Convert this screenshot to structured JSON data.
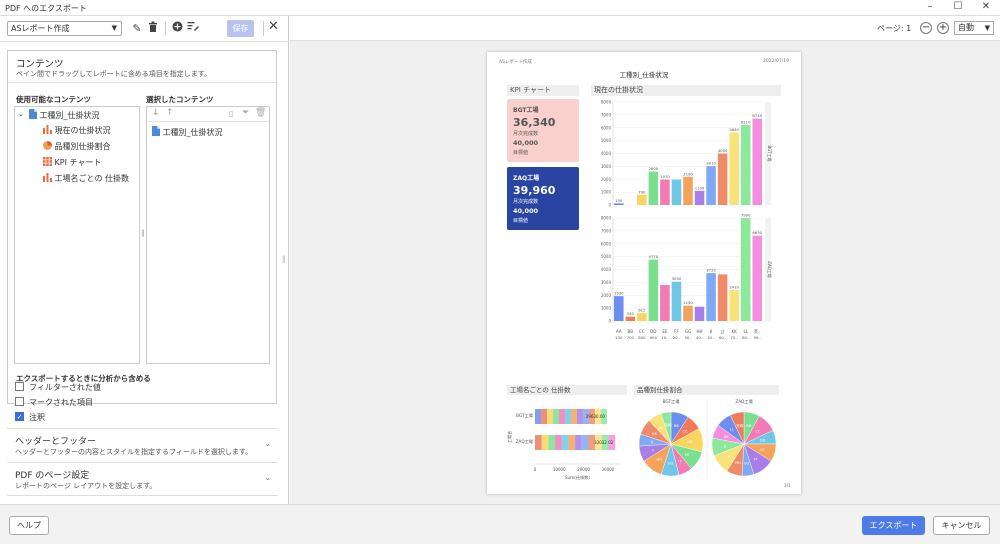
{
  "window": {
    "title": "PDF へのエクスポート"
  },
  "toolbar": {
    "report_select": "ASレポート作成",
    "save_label": "保存"
  },
  "content": {
    "heading": "コンテンツ",
    "description": "ペイン間でドラッグしてレポートに含める項目を指定します。",
    "available_label": "使用可能なコンテンツ",
    "selected_label": "選択したコンテンツ",
    "tree_root": "工種別_仕掛状況",
    "tree_items": [
      "現在の仕掛状況",
      "品種別仕掛割合",
      "KPI チャート",
      "工場名ごとの 仕掛数"
    ],
    "selected_items": [
      "工種別_仕掛状況"
    ]
  },
  "export_options": {
    "heading": "エクスポートするときに分析から含める",
    "items": [
      {
        "label": "フィルターされた値",
        "checked": false
      },
      {
        "label": "マークされた項目",
        "checked": false
      },
      {
        "label": "注釈",
        "checked": true
      }
    ]
  },
  "header_footer": {
    "heading": "ヘッダーとフッター",
    "description": "ヘッダーとフッターの内容とスタイルを指定するフィールドを選択します。"
  },
  "pdf_settings": {
    "heading": "PDF のページ設定",
    "description": "レポートのページ レイアウトを設定します。"
  },
  "preview": {
    "page_label": "ページ: 1",
    "zoom": "自動",
    "doc_header_left": "ASレポート作成",
    "doc_header_right": "2022/07/19",
    "doc_title": "工種別_仕掛状況",
    "footer_page": "1/1",
    "kpi_title": "KPI チャート",
    "kpi_cards": [
      {
        "name": "BGT工場",
        "value": "36,340",
        "value_label": "月次完成数",
        "target": "40,000",
        "target_label": "目標値"
      },
      {
        "name": "ZAQ工場",
        "value": "39,960",
        "value_label": "月次完成数",
        "target": "40,000",
        "target_label": "目標値"
      }
    ],
    "status_title": "現在の仕掛状況",
    "factories_title": "工場名ごとの 仕掛数",
    "pie_title": "品種別仕掛割合"
  },
  "chart_data": [
    {
      "type": "bar",
      "title": "現在の仕掛状況",
      "categories": [
        "AA",
        "BB",
        "CC",
        "DD",
        "EE",
        "FF",
        "GG",
        "HH",
        "II",
        "JJ",
        "KK",
        "LL",
        "荒.."
      ],
      "category_sublabels": [
        "130",
        "700",
        "800",
        "900",
        "10..",
        "20..",
        "30..",
        "40..",
        "50..",
        "60..",
        "70..",
        "80..",
        "99.."
      ],
      "ylim": [
        0,
        8000
      ],
      "yticks": [
        0,
        1000,
        2000,
        3000,
        4000,
        5000,
        6000,
        7000,
        8000
      ],
      "series": [
        {
          "name": "BGT工場",
          "values": [
            130,
            0,
            790,
            2600,
            1970,
            1970,
            2190,
            1100,
            3010,
            4000,
            5640,
            6210,
            6710
          ],
          "labels": [
            "130",
            "",
            "790",
            "2600",
            "1970",
            "",
            "2190",
            "1100",
            "3010",
            "4000",
            "5640",
            "6210",
            "6710"
          ]
        },
        {
          "name": "ZAQ工場",
          "values": [
            1930,
            340,
            612,
            4770,
            2790,
            3050,
            1190,
            1110,
            3720,
            3620,
            2410,
            7990,
            6630
          ],
          "labels": [
            "1930",
            "340",
            "612",
            "4770",
            "",
            "3050",
            "1190",
            "",
            "3720",
            "",
            "2410",
            "7990",
            "6630"
          ]
        }
      ],
      "colors": [
        "#6b8ef0",
        "#f07a5a",
        "#f7d560",
        "#7adf8f",
        "#f37ab5",
        "#6fc7e8",
        "#f5a35a",
        "#a87ee8",
        "#7fa8f5",
        "#f08b6a",
        "#f8e27a",
        "#8ce89a",
        "#f78de0"
      ]
    },
    {
      "type": "bar",
      "title": "工場名ごとの 仕掛数",
      "categories": [
        "BGT工場",
        "ZAQ工場"
      ],
      "values": [
        29630,
        33032
      ],
      "value_labels": [
        "29630.00",
        "33032.02"
      ],
      "xlabel": "Sum(仕掛数)",
      "ylabel": "工場名",
      "xticks": [
        "0",
        "10000",
        "20000",
        "30000"
      ],
      "xlim": [
        0,
        35000
      ]
    },
    {
      "type": "pie",
      "title": "品種別仕掛割合",
      "panels": [
        "BGT工場",
        "ZAQ工場"
      ],
      "slice_labels": [
        "BB",
        "CC",
        "DD",
        "EE",
        "FF",
        "GG",
        "HH",
        "II",
        "JJ",
        "KK",
        "LL",
        "荒明"
      ]
    }
  ]
}
